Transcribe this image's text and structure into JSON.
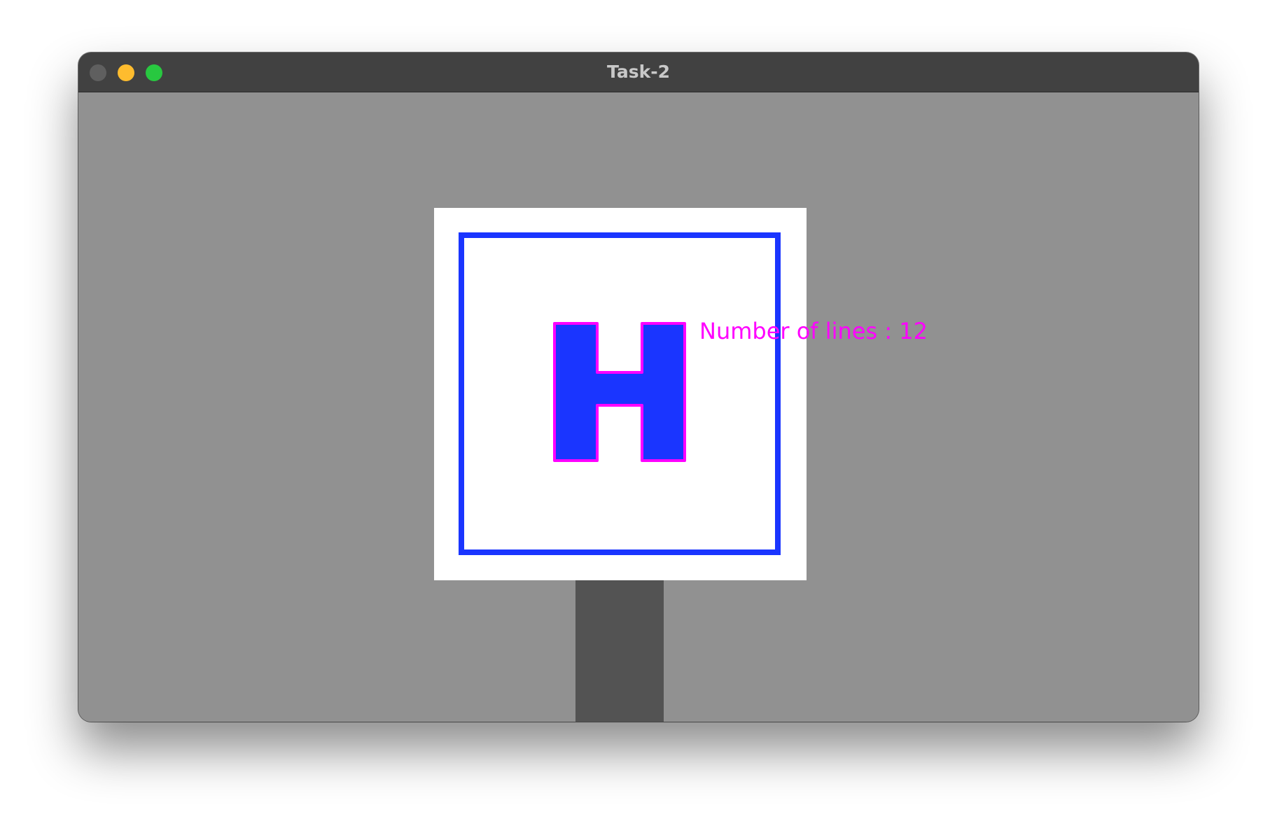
{
  "window": {
    "title": "Task-2"
  },
  "canvas": {
    "overlay_text": "Number of lines : 12"
  },
  "colors": {
    "background": "#919191",
    "sign": "#ffffff",
    "sign_border": "#1a35ff",
    "letter_fill": "#1a35ff",
    "contour": "#ff00ff",
    "pole": "#535353",
    "titlebar": "#414141"
  }
}
